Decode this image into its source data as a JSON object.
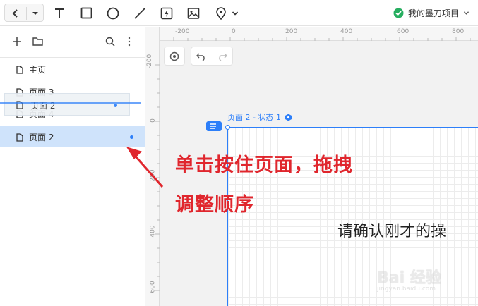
{
  "toolbar": {
    "project_name": "我的墨刀项目",
    "status_color": "#27ae60"
  },
  "sidebar": {
    "pages": [
      {
        "label": "主页"
      },
      {
        "label": "页面 3"
      },
      {
        "label": "页面 4"
      },
      {
        "label": "页面 2",
        "selected": true
      }
    ],
    "drag_ghost_label": "页面 2"
  },
  "canvas": {
    "ruler_top_ticks": [
      "-200",
      "0",
      "200",
      "400",
      "600",
      "800"
    ],
    "ruler_left_ticks": [
      "-200",
      "0",
      "200",
      "400",
      "600"
    ],
    "frame_label": "页面 2 - 状态 1",
    "content_text": "请确认刚才的操",
    "accent_color": "#2d7ff9"
  },
  "annotation": {
    "line1": "单击按住页面，拖拽",
    "line2": "调整顺序",
    "color": "#e0262d"
  },
  "watermark": {
    "text": "Bai 经验",
    "sub": "jingyan.baidu.com"
  }
}
